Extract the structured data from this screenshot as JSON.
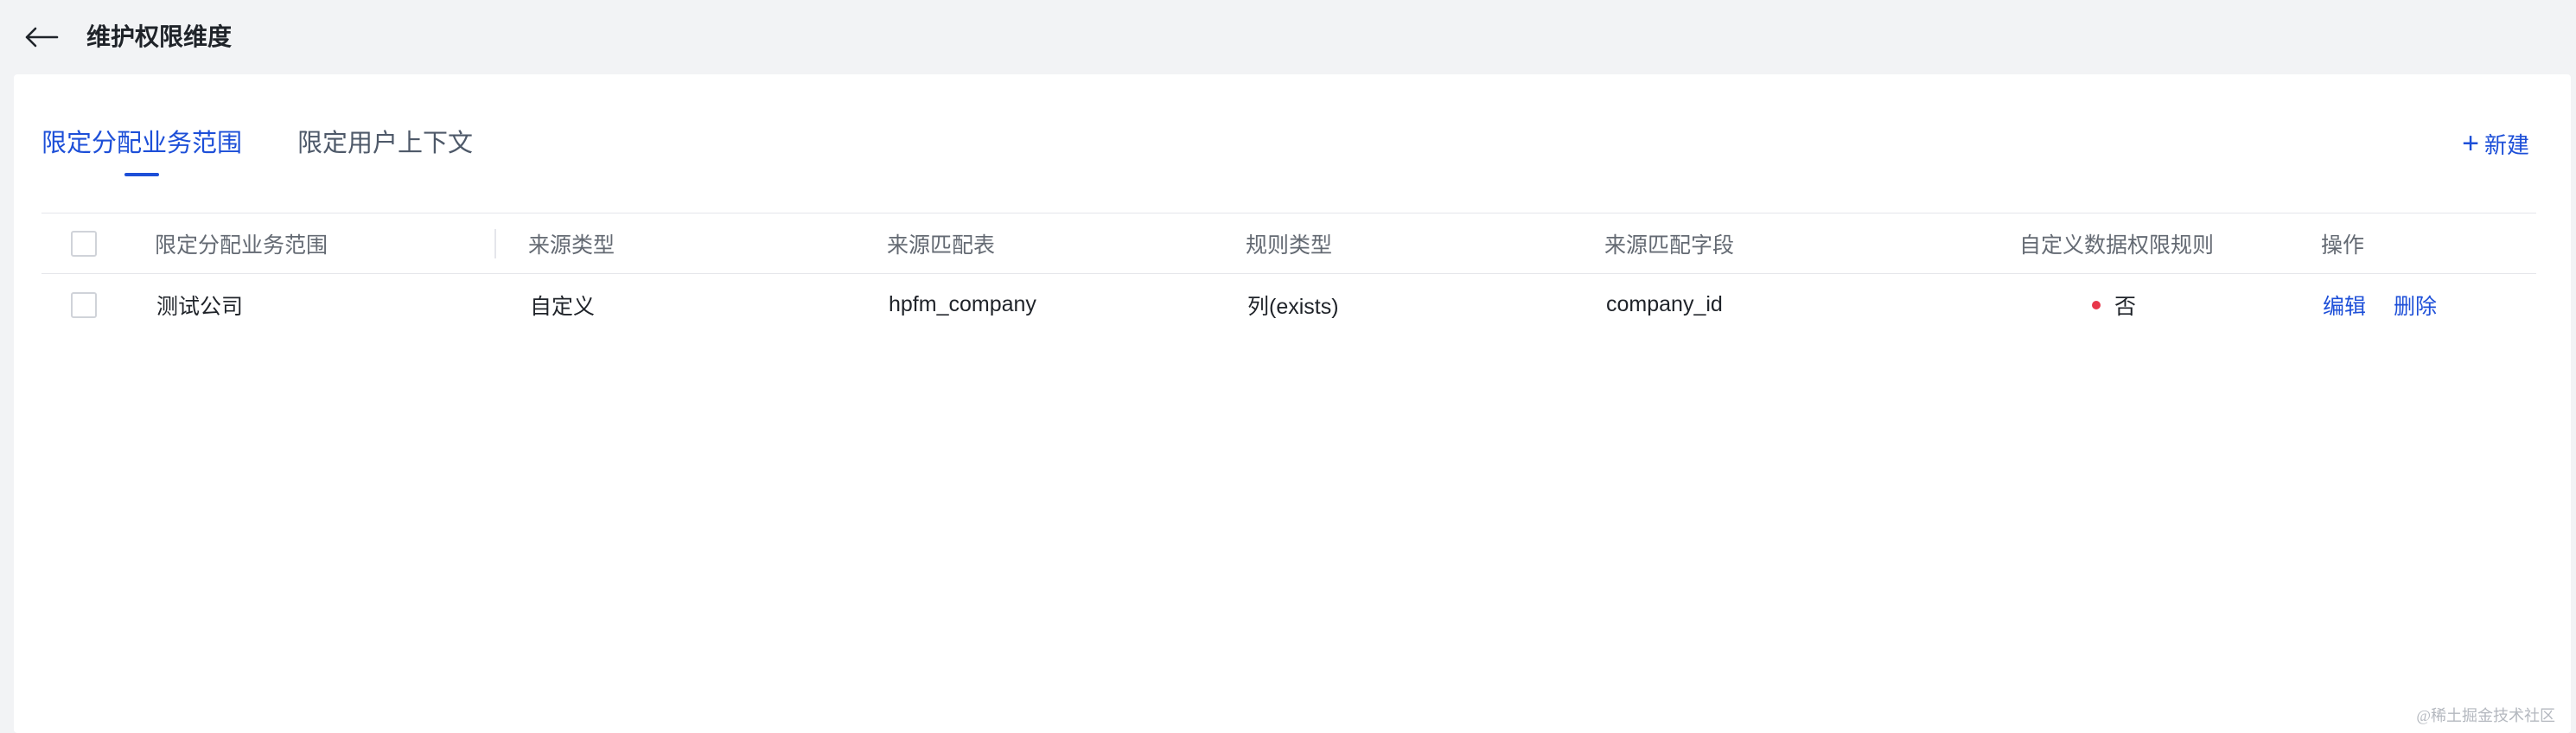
{
  "header": {
    "title": "维护权限维度",
    "back_icon": "arrow-left-icon"
  },
  "tabs": [
    {
      "label": "限定分配业务范围",
      "active": true
    },
    {
      "label": "限定用户上下文",
      "active": false
    }
  ],
  "toolbar": {
    "new_label": "新建",
    "new_icon": "plus-icon"
  },
  "table": {
    "columns": [
      "限定分配业务范围",
      "来源类型",
      "来源匹配表",
      "规则类型",
      "来源匹配字段",
      "自定义数据权限规则",
      "操作"
    ],
    "rows": [
      {
        "scope": "测试公司",
        "source_type": "自定义",
        "source_table": "hpfm_company",
        "rule_type": "列(exists)",
        "source_field": "company_id",
        "custom_rule": "否",
        "actions": {
          "edit": "编辑",
          "delete": "删除"
        }
      }
    ]
  },
  "colors": {
    "accent": "#1d4fd8",
    "status_no": "#e8364a",
    "background": "#f2f3f5"
  },
  "watermark": "@稀土掘金技术社区"
}
